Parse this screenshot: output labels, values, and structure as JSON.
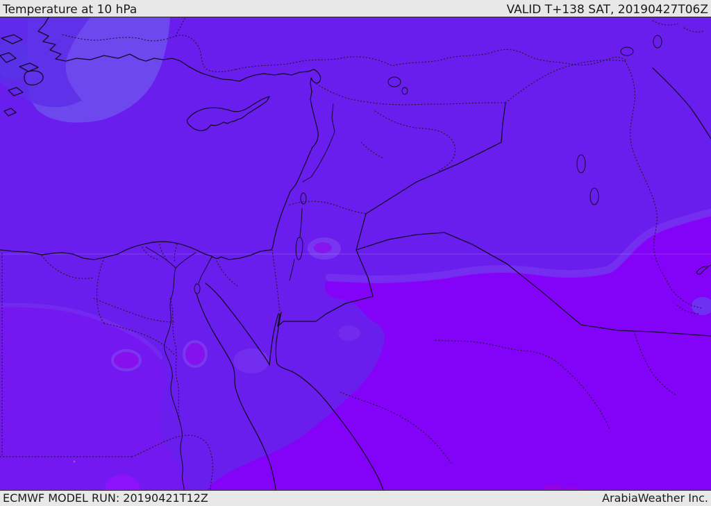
{
  "header": {
    "title": "Temperature at 10 hPa",
    "validity": "VALID T+138 SAT, 20190427T06Z"
  },
  "footer": {
    "model_run": "ECMWF MODEL RUN: 20190421T12Z",
    "credit": "ArabiaWeather Inc."
  },
  "map": {
    "kind": "upper-air temperature shading over the Middle East and Eastern Mediterranean",
    "colors": {
      "bar_bg": "#e8e8e8",
      "bar_text": "#1a1a1a",
      "base_north": "#691eee",
      "base_south": "#8203f8",
      "lobe_light_blue": "#6c48ee",
      "corner_blue": "#5d2de8",
      "corner_blue_deep": "#5336e2",
      "southwest_violet": "#7517f0",
      "lavender_band": "#7d3cf0",
      "blob_core_magenta": "#8a0fee",
      "blob_bright": "#8b12fa",
      "blob_dark_magenta": "#9506e0",
      "edge_blue_blob": "#6b36f2",
      "pink_dot": "#c23bd8",
      "coastline": "#150929",
      "border_dotted": "#2b1638",
      "graticule": "#ffffff"
    }
  }
}
